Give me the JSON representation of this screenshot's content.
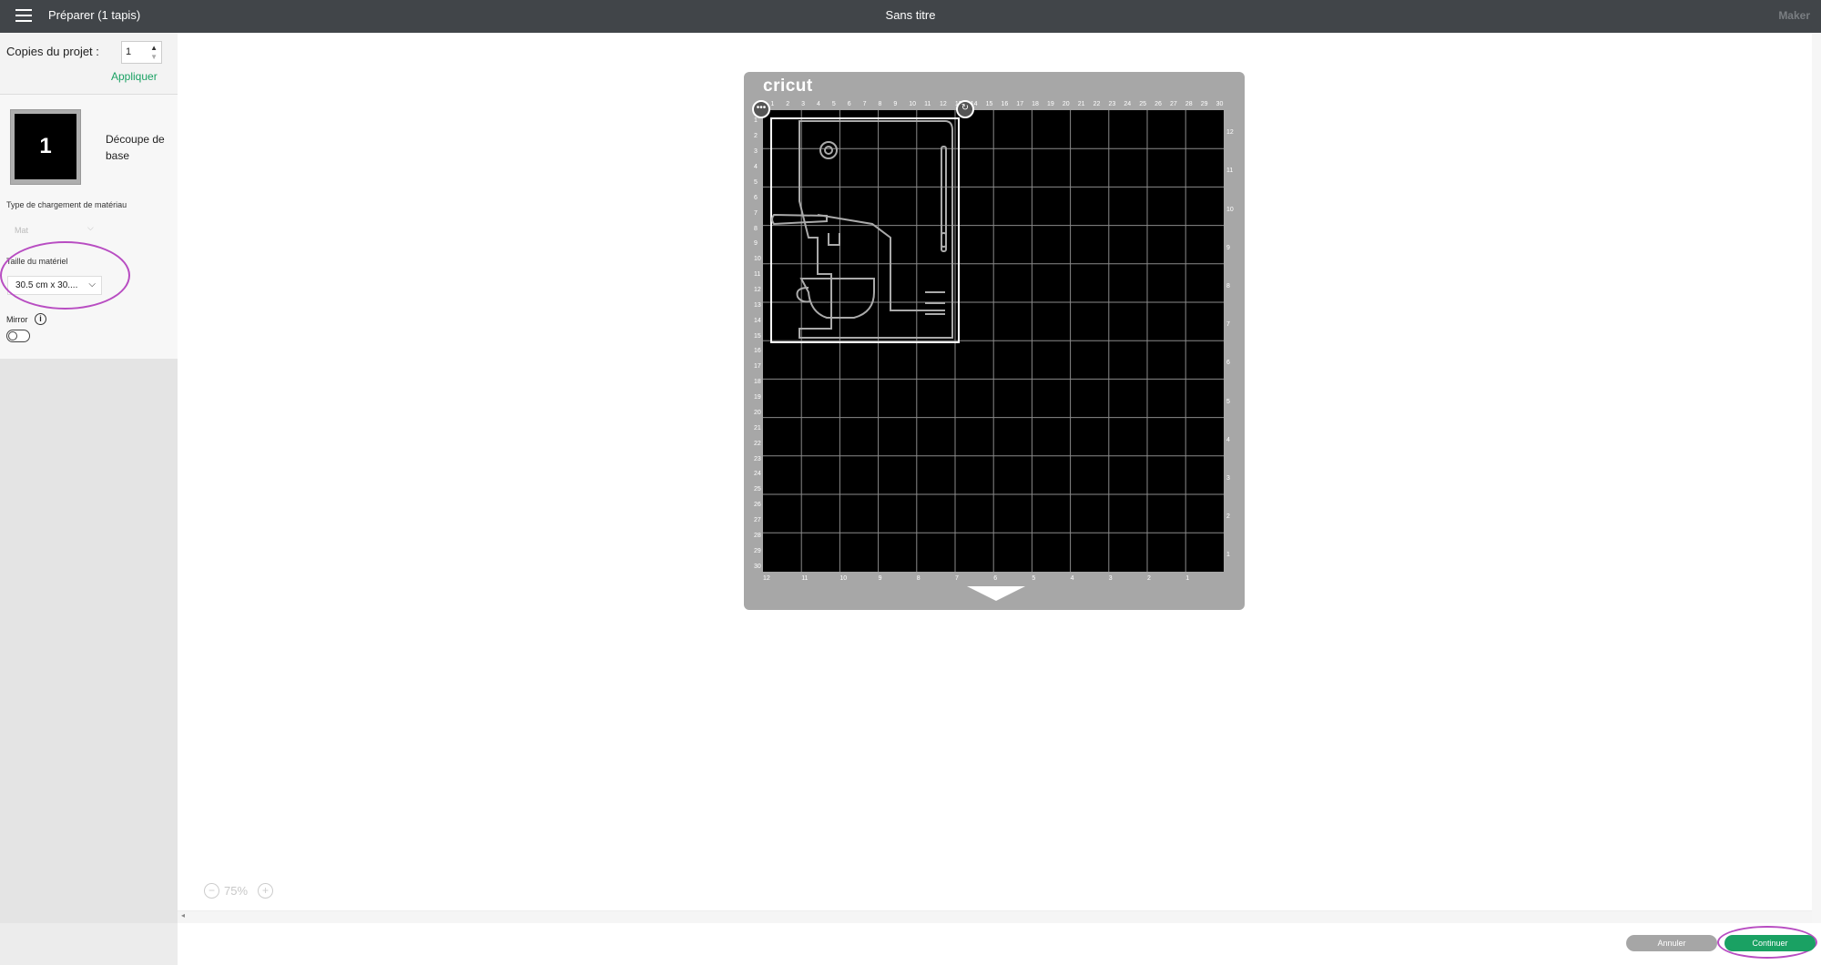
{
  "header": {
    "app_title": "Préparer (1 tapis)",
    "doc_title": "Sans titre",
    "machine": "Maker"
  },
  "panel": {
    "copies_label": "Copies du projet :",
    "copies_value": "1",
    "apply_label": "Appliquer",
    "mat_number": "1",
    "mat_name": "Découpe de base",
    "load_type_label": "Type de chargement de matériau",
    "load_type_value": "Mat",
    "material_size_label": "Taille du matériel",
    "material_size_value": "30.5 cm x 30....",
    "mirror_label": "Mirror",
    "mirror_on": false
  },
  "mat": {
    "brand": "cricut",
    "top_ticks": [
      "1",
      "2",
      "3",
      "4",
      "5",
      "6",
      "7",
      "8",
      "9",
      "10",
      "11",
      "12",
      "13",
      "14",
      "15",
      "16",
      "17",
      "18",
      "19",
      "20",
      "21",
      "22",
      "23",
      "24",
      "25",
      "26",
      "27",
      "28",
      "29",
      "30"
    ],
    "left_ticks": [
      "1",
      "2",
      "3",
      "4",
      "5",
      "6",
      "7",
      "8",
      "9",
      "10",
      "11",
      "12",
      "13",
      "14",
      "15",
      "16",
      "17",
      "18",
      "19",
      "20",
      "21",
      "22",
      "23",
      "24",
      "25",
      "26",
      "27",
      "28",
      "29",
      "30"
    ],
    "right_ticks": [
      "12",
      "11",
      "10",
      "9",
      "8",
      "7",
      "6",
      "5",
      "4",
      "3",
      "2",
      "1"
    ],
    "bottom_ticks": [
      "12",
      "11",
      "10",
      "9",
      "8",
      "7",
      "6",
      "5",
      "4",
      "3",
      "2",
      "1"
    ],
    "more_icon": "ellipsis-icon",
    "rotate_icon": "rotate-icon"
  },
  "zoom": {
    "value": "75%"
  },
  "footer": {
    "cancel_label": "Annuler",
    "continue_label": "Continuer"
  },
  "colors": {
    "accent": "#1aa163",
    "highlight": "#b84dc2",
    "topbar": "#414549"
  }
}
